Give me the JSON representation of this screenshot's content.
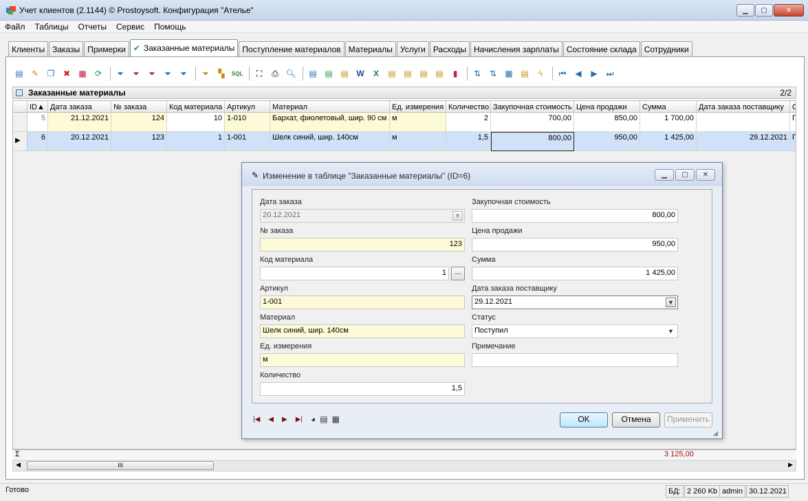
{
  "window": {
    "title": "Учет клиентов (2.1144) © Prostoysoft. Конфигурация \"Ателье\""
  },
  "menu": [
    "Файл",
    "Таблицы",
    "Отчеты",
    "Сервис",
    "Помощь"
  ],
  "tabs": [
    "Клиенты",
    "Заказы",
    "Примерки",
    "Заказанные материалы",
    "Поступление материалов",
    "Материалы",
    "Услуги",
    "Расходы",
    "Начисления зарплаты",
    "Состояние склада",
    "Сотрудники"
  ],
  "grid": {
    "title": "Заказанные материалы",
    "count": "2/2",
    "columns": [
      "ID",
      "Дата заказа",
      "№ заказа",
      "Код материала",
      "Артикул",
      "Материал",
      "Ед. измерения",
      "Количество",
      "Закупочная стоимость",
      "Цена продажи",
      "Сумма",
      "Дата заказа поставщику",
      "С"
    ],
    "rows": [
      {
        "id": "5",
        "date": "21.12.2021",
        "order": "124",
        "code": "10",
        "article": "1-010",
        "material": "Бархат, фиолетовый, шир. 90 см",
        "unit": "м",
        "qty": "2",
        "cost": "700,00",
        "price": "850,00",
        "sum": "1 700,00",
        "supplier_date": "",
        "status": "П"
      },
      {
        "id": "6",
        "date": "20.12.2021",
        "order": "123",
        "code": "1",
        "article": "1-001",
        "material": "Шелк синий, шир. 140см",
        "unit": "м",
        "qty": "1,5",
        "cost": "800,00",
        "price": "950,00",
        "sum": "1 425,00",
        "supplier_date": "29.12.2021",
        "status": "П"
      }
    ],
    "sum_symbol": "Σ",
    "sum_total": "3 125,00",
    "scroll_thumb": "III"
  },
  "dialog": {
    "title": "Изменение в таблице \"Заказанные материалы\" (ID=6)",
    "fields": {
      "order_date": {
        "label": "Дата заказа",
        "value": "20.12.2021"
      },
      "order_no": {
        "label": "№ заказа",
        "value": "123"
      },
      "material_code": {
        "label": "Код материала",
        "value": "1",
        "button": "..."
      },
      "article": {
        "label": "Артикул",
        "value": "1-001"
      },
      "material": {
        "label": "Материал",
        "value": "Шелк синий, шир. 140см"
      },
      "unit": {
        "label": "Ед. измерения",
        "value": "м"
      },
      "qty": {
        "label": "Количество",
        "value": "1,5"
      },
      "cost": {
        "label": "Закупочная стоимость",
        "value": "800,00"
      },
      "price": {
        "label": "Цена продажи",
        "value": "950,00"
      },
      "sum": {
        "label": "Сумма",
        "value": "1 425,00"
      },
      "supplier_date": {
        "label": "Дата заказа поставщику",
        "value": "29.12.2021"
      },
      "status": {
        "label": "Статус",
        "value": "Поступил"
      },
      "note": {
        "label": "Примечание",
        "value": ""
      }
    },
    "buttons": {
      "ok": "OK",
      "cancel": "Отмена",
      "apply": "Применить"
    }
  },
  "statusbar": {
    "text": "Готово",
    "db_label": "БД:",
    "db_size": "2 260 Kb",
    "user": "admin",
    "date": "30.12.2021"
  }
}
